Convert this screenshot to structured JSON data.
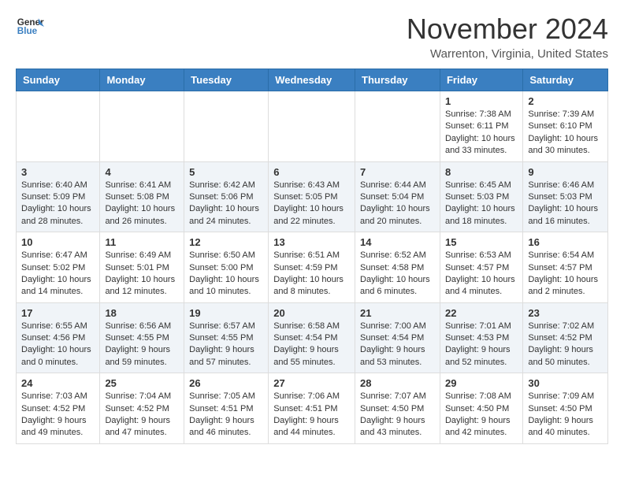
{
  "header": {
    "logo_general": "General",
    "logo_blue": "Blue",
    "month": "November 2024",
    "location": "Warrenton, Virginia, United States"
  },
  "weekdays": [
    "Sunday",
    "Monday",
    "Tuesday",
    "Wednesday",
    "Thursday",
    "Friday",
    "Saturday"
  ],
  "weeks": [
    [
      null,
      null,
      null,
      null,
      null,
      {
        "day": 1,
        "sunrise": "7:38 AM",
        "sunset": "6:11 PM",
        "daylight": "10 hours and 33 minutes."
      },
      {
        "day": 2,
        "sunrise": "7:39 AM",
        "sunset": "6:10 PM",
        "daylight": "10 hours and 30 minutes."
      }
    ],
    [
      {
        "day": 3,
        "sunrise": "6:40 AM",
        "sunset": "5:09 PM",
        "daylight": "10 hours and 28 minutes."
      },
      {
        "day": 4,
        "sunrise": "6:41 AM",
        "sunset": "5:08 PM",
        "daylight": "10 hours and 26 minutes."
      },
      {
        "day": 5,
        "sunrise": "6:42 AM",
        "sunset": "5:06 PM",
        "daylight": "10 hours and 24 minutes."
      },
      {
        "day": 6,
        "sunrise": "6:43 AM",
        "sunset": "5:05 PM",
        "daylight": "10 hours and 22 minutes."
      },
      {
        "day": 7,
        "sunrise": "6:44 AM",
        "sunset": "5:04 PM",
        "daylight": "10 hours and 20 minutes."
      },
      {
        "day": 8,
        "sunrise": "6:45 AM",
        "sunset": "5:03 PM",
        "daylight": "10 hours and 18 minutes."
      },
      {
        "day": 9,
        "sunrise": "6:46 AM",
        "sunset": "5:03 PM",
        "daylight": "10 hours and 16 minutes."
      }
    ],
    [
      {
        "day": 10,
        "sunrise": "6:47 AM",
        "sunset": "5:02 PM",
        "daylight": "10 hours and 14 minutes."
      },
      {
        "day": 11,
        "sunrise": "6:49 AM",
        "sunset": "5:01 PM",
        "daylight": "10 hours and 12 minutes."
      },
      {
        "day": 12,
        "sunrise": "6:50 AM",
        "sunset": "5:00 PM",
        "daylight": "10 hours and 10 minutes."
      },
      {
        "day": 13,
        "sunrise": "6:51 AM",
        "sunset": "4:59 PM",
        "daylight": "10 hours and 8 minutes."
      },
      {
        "day": 14,
        "sunrise": "6:52 AM",
        "sunset": "4:58 PM",
        "daylight": "10 hours and 6 minutes."
      },
      {
        "day": 15,
        "sunrise": "6:53 AM",
        "sunset": "4:57 PM",
        "daylight": "10 hours and 4 minutes."
      },
      {
        "day": 16,
        "sunrise": "6:54 AM",
        "sunset": "4:57 PM",
        "daylight": "10 hours and 2 minutes."
      }
    ],
    [
      {
        "day": 17,
        "sunrise": "6:55 AM",
        "sunset": "4:56 PM",
        "daylight": "10 hours and 0 minutes."
      },
      {
        "day": 18,
        "sunrise": "6:56 AM",
        "sunset": "4:55 PM",
        "daylight": "9 hours and 59 minutes."
      },
      {
        "day": 19,
        "sunrise": "6:57 AM",
        "sunset": "4:55 PM",
        "daylight": "9 hours and 57 minutes."
      },
      {
        "day": 20,
        "sunrise": "6:58 AM",
        "sunset": "4:54 PM",
        "daylight": "9 hours and 55 minutes."
      },
      {
        "day": 21,
        "sunrise": "7:00 AM",
        "sunset": "4:54 PM",
        "daylight": "9 hours and 53 minutes."
      },
      {
        "day": 22,
        "sunrise": "7:01 AM",
        "sunset": "4:53 PM",
        "daylight": "9 hours and 52 minutes."
      },
      {
        "day": 23,
        "sunrise": "7:02 AM",
        "sunset": "4:52 PM",
        "daylight": "9 hours and 50 minutes."
      }
    ],
    [
      {
        "day": 24,
        "sunrise": "7:03 AM",
        "sunset": "4:52 PM",
        "daylight": "9 hours and 49 minutes."
      },
      {
        "day": 25,
        "sunrise": "7:04 AM",
        "sunset": "4:52 PM",
        "daylight": "9 hours and 47 minutes."
      },
      {
        "day": 26,
        "sunrise": "7:05 AM",
        "sunset": "4:51 PM",
        "daylight": "9 hours and 46 minutes."
      },
      {
        "day": 27,
        "sunrise": "7:06 AM",
        "sunset": "4:51 PM",
        "daylight": "9 hours and 44 minutes."
      },
      {
        "day": 28,
        "sunrise": "7:07 AM",
        "sunset": "4:50 PM",
        "daylight": "9 hours and 43 minutes."
      },
      {
        "day": 29,
        "sunrise": "7:08 AM",
        "sunset": "4:50 PM",
        "daylight": "9 hours and 42 minutes."
      },
      {
        "day": 30,
        "sunrise": "7:09 AM",
        "sunset": "4:50 PM",
        "daylight": "9 hours and 40 minutes."
      }
    ]
  ],
  "labels": {
    "sunrise": "Sunrise:",
    "sunset": "Sunset:",
    "daylight": "Daylight:"
  }
}
